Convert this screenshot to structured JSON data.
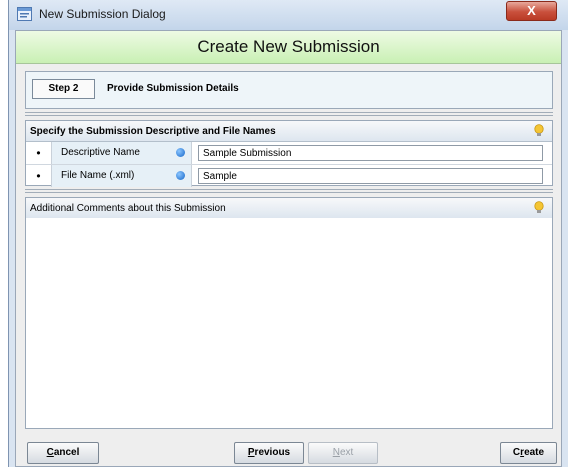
{
  "window": {
    "title": "New Submission Dialog",
    "close_glyph": "X"
  },
  "banner": {
    "title": "Create New Submission"
  },
  "step": {
    "label": "Step 2",
    "description": "Provide Submission Details"
  },
  "names_section": {
    "header": "Specify the Submission Descriptive and File Names",
    "rows": [
      {
        "bullet": "•",
        "label": "Descriptive Name",
        "value": "Sample Submission"
      },
      {
        "bullet": "•",
        "label": "File Name (.xml)",
        "value": "Sample"
      }
    ]
  },
  "comments_section": {
    "header": "Additional Comments about this Submission",
    "value": ""
  },
  "buttons": {
    "cancel": {
      "mnemonic": "C",
      "rest": "ancel"
    },
    "previous": {
      "mnemonic": "P",
      "rest": "revious"
    },
    "next": {
      "mnemonic": "N",
      "rest": "ext"
    },
    "create": {
      "pre": "C",
      "mnemonic": "r",
      "rest": "eate"
    }
  },
  "colors": {
    "banner_green": "#c9f0b4",
    "required_dot": "#1566c8",
    "close_red": "#c9503c"
  },
  "icons": {
    "app": "app-window-icon",
    "hint": "lightbulb-icon",
    "required": "required-dot-icon"
  }
}
